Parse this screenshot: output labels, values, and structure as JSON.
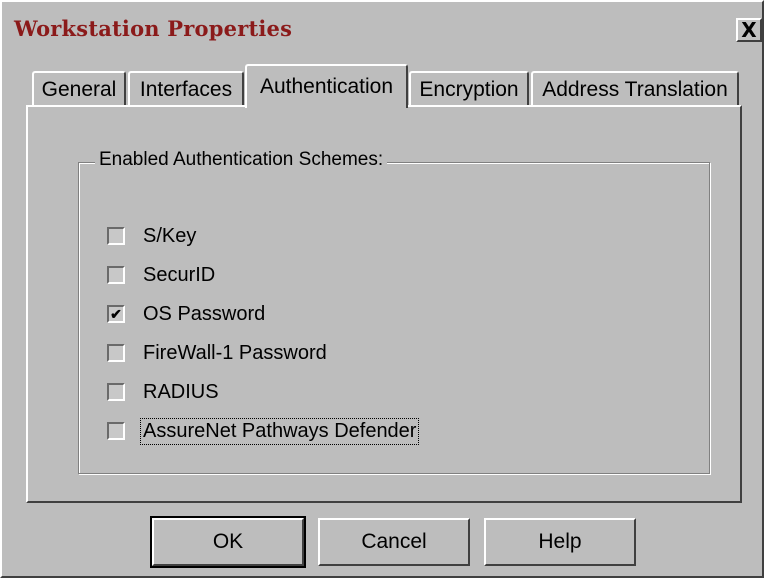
{
  "window": {
    "title": "Workstation Properties",
    "close_label": "X"
  },
  "tabs": [
    {
      "label": "General",
      "active": false
    },
    {
      "label": "Interfaces",
      "active": false
    },
    {
      "label": "Authentication",
      "active": true
    },
    {
      "label": "Encryption",
      "active": false
    },
    {
      "label": "Address Translation",
      "active": false
    }
  ],
  "group": {
    "label": "Enabled Authentication Schemes:",
    "schemes": [
      {
        "label": "S/Key",
        "checked": false
      },
      {
        "label": "SecurID",
        "checked": false
      },
      {
        "label": "OS Password",
        "checked": true
      },
      {
        "label": "FireWall-1 Password",
        "checked": false
      },
      {
        "label": "RADIUS",
        "checked": false
      },
      {
        "label": "AssureNet Pathways Defender",
        "checked": false,
        "focused": true
      }
    ]
  },
  "buttons": {
    "ok": "OK",
    "cancel": "Cancel",
    "help": "Help"
  },
  "colors": {
    "title": "#8b1a1a",
    "face": "#bdbdbd"
  }
}
